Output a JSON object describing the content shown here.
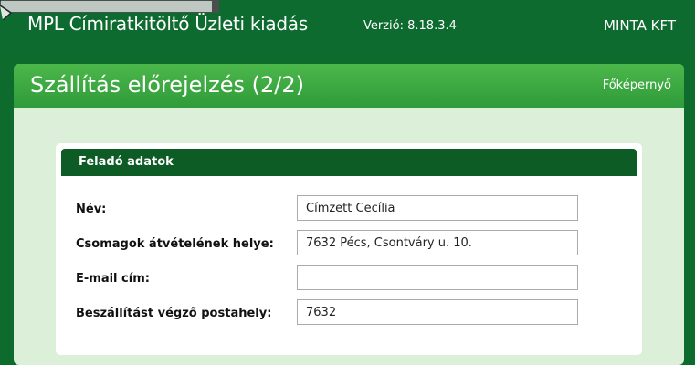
{
  "app": {
    "title": "MPL Címiratkitöltő Üzleti kiadás",
    "version": "Verzió: 8.18.3.4",
    "company": "MINTA KFT"
  },
  "page": {
    "title": "Szállítás előrejelzés (2/2)",
    "home_link": "Főképernyő"
  },
  "sender": {
    "section_title": "Feladó adatok",
    "fields": [
      {
        "label": "Név:",
        "value": "Címzett Cecília"
      },
      {
        "label": "Csomagok átvételének helye:",
        "value": "7632 Pécs, Csontváry u. 10."
      },
      {
        "label": "E-mail cím:",
        "value": ""
      },
      {
        "label": "Beszállítást végző postahely:",
        "value": "7632"
      }
    ]
  },
  "colors": {
    "topbar": "#0e6b2f",
    "panel_header": "#3aa842",
    "card_header": "#0e5c25",
    "panel_bg": "#dcefd9"
  }
}
